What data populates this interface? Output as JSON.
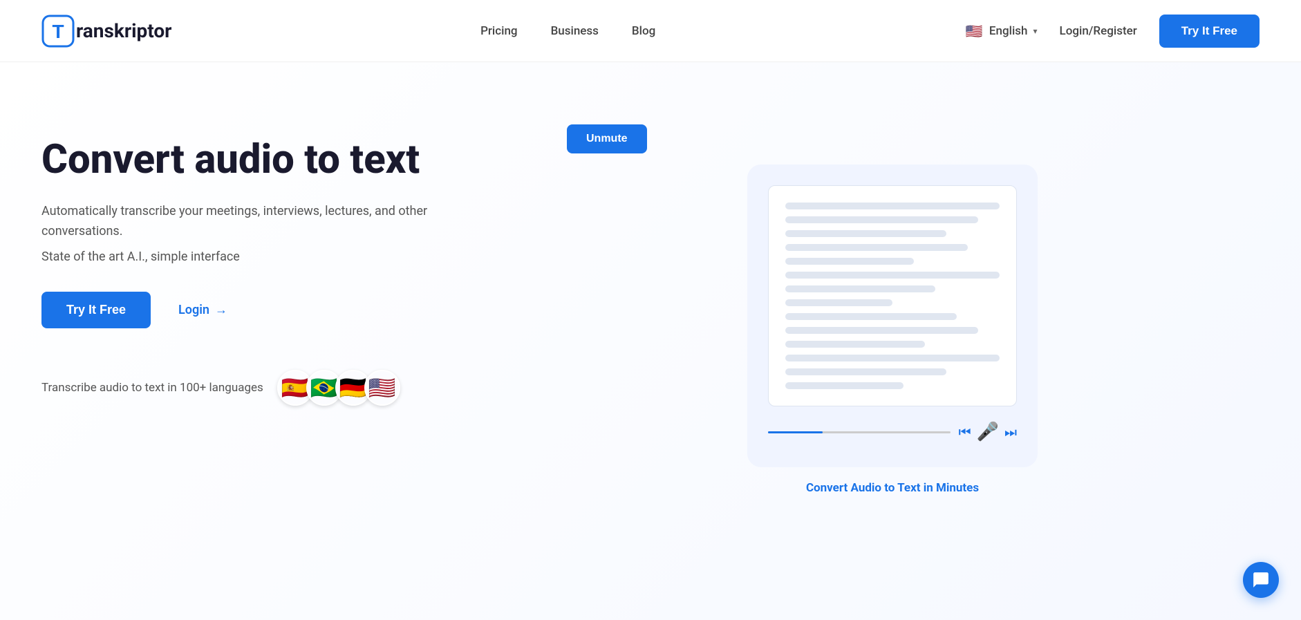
{
  "nav": {
    "logo_text": "ranskriptor",
    "links": [
      {
        "label": "Pricing",
        "href": "#"
      },
      {
        "label": "Business",
        "href": "#"
      },
      {
        "label": "Blog",
        "href": "#"
      }
    ],
    "lang_label": "English",
    "login_label": "Login/Register",
    "try_free_label": "Try It Free"
  },
  "hero": {
    "title": "Convert audio to text",
    "subtitle": "Automatically transcribe your meetings, interviews, lectures, and other conversations.",
    "subtitle2": "State of the art A.I., simple interface",
    "try_free_label": "Try It Free",
    "login_label": "Login",
    "login_arrow": "→",
    "languages_text": "Transcribe audio to text in 100+ languages",
    "flags": [
      "🇪🇸",
      "🇧🇷",
      "🇩🇪",
      "🇺🇸"
    ],
    "unmute_label": "Unmute",
    "convert_caption": "Convert Audio to Text in Minutes"
  }
}
